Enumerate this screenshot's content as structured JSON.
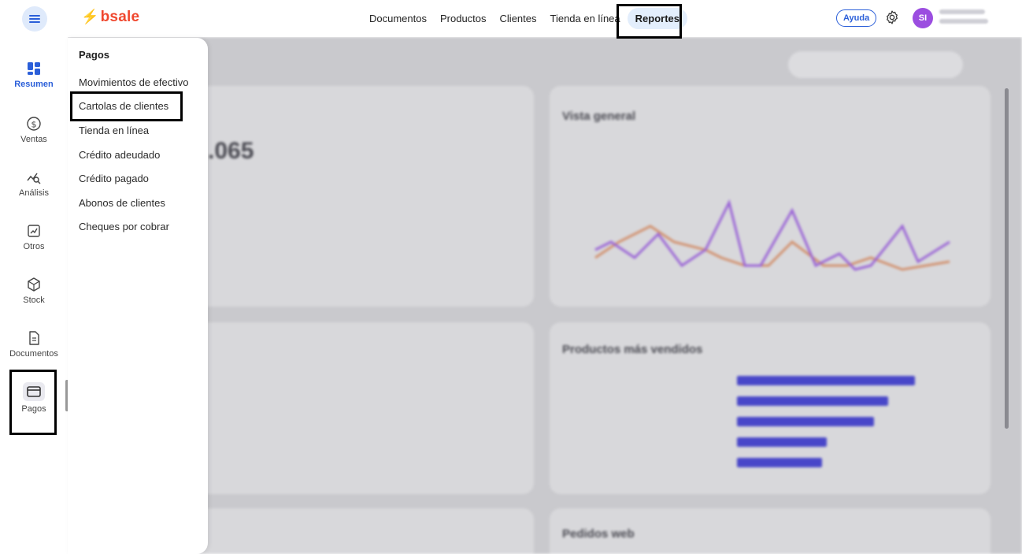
{
  "app": {
    "logo": "bsale"
  },
  "topnav": {
    "items": [
      "Documentos",
      "Productos",
      "Clientes",
      "Tienda en línea"
    ],
    "active": "Reportes"
  },
  "header": {
    "help_label": "Ayuda",
    "avatar_initials": "SI"
  },
  "sidebar": {
    "items": [
      {
        "label": "Resumen",
        "icon": "dashboard-icon"
      },
      {
        "label": "Ventas",
        "icon": "dollar-circle-icon"
      },
      {
        "label": "Análisis",
        "icon": "analysis-icon"
      },
      {
        "label": "Otros",
        "icon": "trend-chart-icon"
      },
      {
        "label": "Stock",
        "icon": "box-icon"
      },
      {
        "label": "Documentos",
        "icon": "document-icon"
      },
      {
        "label": "Pagos",
        "icon": "card-icon"
      }
    ]
  },
  "dropdown": {
    "title": "Pagos",
    "items": [
      "Movimientos de efectivo",
      "Cartolas de clientes",
      "Tienda en línea",
      "Crédito adeudado",
      "Crédito pagado",
      "Abonos de clientes",
      "Cheques por cobrar"
    ]
  },
  "dashboard": {
    "big_value": ".065",
    "card_titles": [
      "Vista general",
      "Productos más vendidos",
      "Pedidos web"
    ]
  },
  "colors": {
    "accent": "#2b5fd9",
    "brand": "#f0482f",
    "avatar": "#9b4de0"
  }
}
